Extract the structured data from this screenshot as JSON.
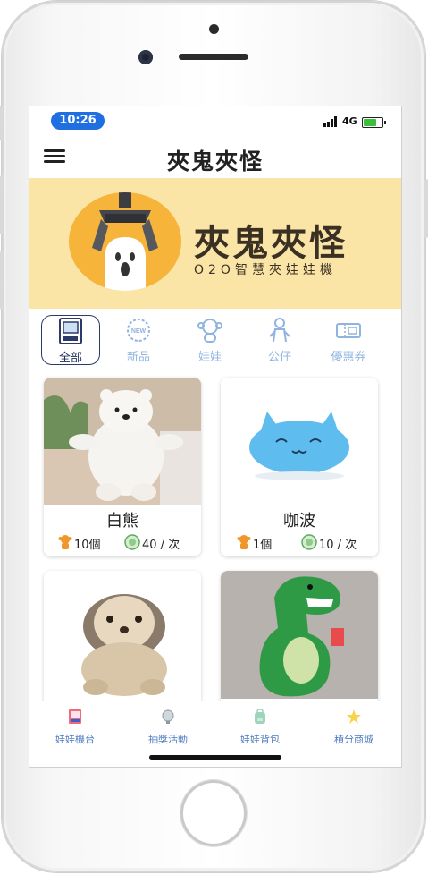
{
  "status": {
    "time": "10:26",
    "network": "4G"
  },
  "app": {
    "title": "夾鬼夾怪"
  },
  "banner": {
    "title": "夾鬼夾怪",
    "subtitle": "O2O智慧夾娃娃機"
  },
  "categories": [
    {
      "label": "全部",
      "icon": "machine-icon",
      "active": true
    },
    {
      "label": "新品",
      "icon": "new-badge-icon",
      "active": false
    },
    {
      "label": "娃娃",
      "icon": "monkey-doll-icon",
      "active": false
    },
    {
      "label": "公仔",
      "icon": "figure-icon",
      "active": false
    },
    {
      "label": "優惠券",
      "icon": "coupon-icon",
      "active": false
    }
  ],
  "products": [
    {
      "name": "白熊",
      "stock": "10個",
      "price": "40 / 次"
    },
    {
      "name": "咖波",
      "stock": "1個",
      "price": "10 / 次"
    },
    {
      "name": "",
      "stock": "",
      "price": ""
    },
    {
      "name": "",
      "stock": "",
      "price": ""
    }
  ],
  "tabs": [
    {
      "label": "娃娃機台",
      "icon": "claw-machine-icon"
    },
    {
      "label": "抽獎活動",
      "icon": "lottery-icon"
    },
    {
      "label": "娃娃背包",
      "icon": "backpack-icon"
    },
    {
      "label": "積分商城",
      "icon": "points-shop-icon"
    }
  ],
  "colors": {
    "accent": "#1f6fe0",
    "banner": "#fbe5a6",
    "logo": "#f6b43a",
    "tab_text": "#4e7cc0"
  }
}
